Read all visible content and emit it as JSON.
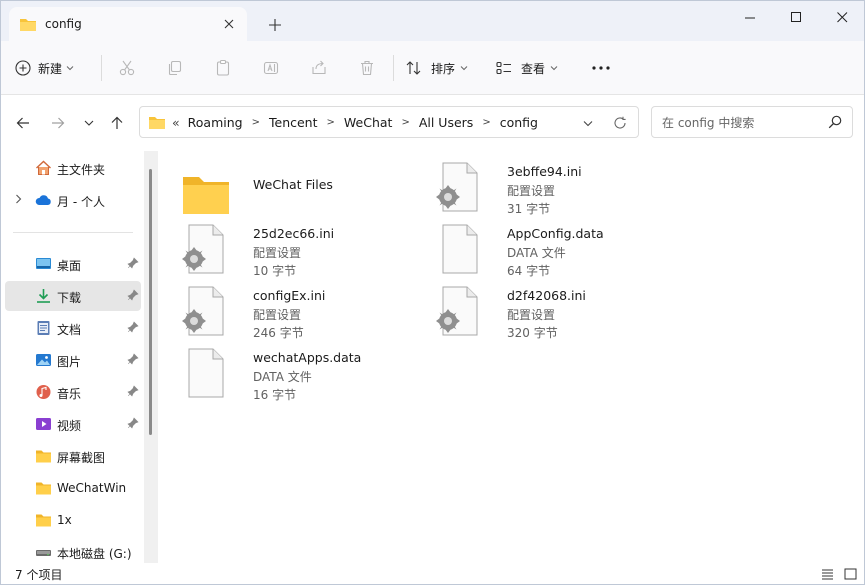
{
  "window": {
    "tab_title": "config",
    "new_tab_glyph": "+",
    "close_tab_glyph": "✕"
  },
  "toolbar": {
    "new_label": "新建",
    "sort_label": "排序",
    "view_label": "查看",
    "more_glyph": "···"
  },
  "address": {
    "overflow_glyph": "«",
    "crumbs": [
      "Roaming",
      "Tencent",
      "WeChat",
      "All Users",
      "config"
    ],
    "separator_glyph": ">"
  },
  "search": {
    "placeholder": "在 config 中搜索"
  },
  "sidebar": {
    "items": [
      {
        "label": "主文件夹",
        "icon": "home-icon"
      },
      {
        "label": "月 - 个人",
        "icon": "onedrive-cloud-icon"
      },
      {
        "label": "桌面",
        "icon": "desktop-icon",
        "pinned": true
      },
      {
        "label": "下载",
        "icon": "download-icon",
        "pinned": true,
        "selected": true
      },
      {
        "label": "文档",
        "icon": "documents-icon",
        "pinned": true
      },
      {
        "label": "图片",
        "icon": "pictures-icon",
        "pinned": true
      },
      {
        "label": "音乐",
        "icon": "music-icon",
        "pinned": true
      },
      {
        "label": "视频",
        "icon": "videos-icon",
        "pinned": true
      },
      {
        "label": "屏幕截图",
        "icon": "folder-icon"
      },
      {
        "label": "WeChatWin",
        "icon": "folder-icon"
      },
      {
        "label": "1x",
        "icon": "folder-icon"
      },
      {
        "label": "本地磁盘 (G:)",
        "icon": "drive-icon"
      }
    ]
  },
  "files": [
    {
      "name": "WeChat Files",
      "type": "",
      "size": "",
      "kind": "folder"
    },
    {
      "name": "3ebffe94.ini",
      "type": "配置设置",
      "size": "31 字节",
      "kind": "ini"
    },
    {
      "name": "25d2ec66.ini",
      "type": "配置设置",
      "size": "10 字节",
      "kind": "ini"
    },
    {
      "name": "AppConfig.data",
      "type": "DATA 文件",
      "size": "64 字节",
      "kind": "data"
    },
    {
      "name": "configEx.ini",
      "type": "配置设置",
      "size": "246 字节",
      "kind": "ini"
    },
    {
      "name": "d2f42068.ini",
      "type": "配置设置",
      "size": "320 字节",
      "kind": "ini"
    },
    {
      "name": "wechatApps.data",
      "type": "DATA 文件",
      "size": "16 字节",
      "kind": "data"
    }
  ],
  "status": {
    "item_count": "7 个项目"
  },
  "colors": {
    "folder": "#f8c43a",
    "accent": "#0067c0",
    "selected_bg": "#e6e6e6"
  }
}
